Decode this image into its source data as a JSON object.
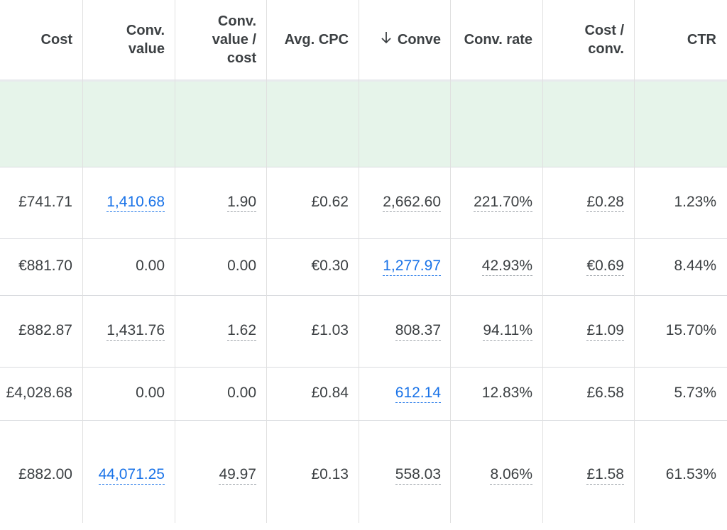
{
  "columns": [
    {
      "key": "cost",
      "label_lines": [
        "Cost"
      ]
    },
    {
      "key": "conv_value",
      "label_lines": [
        "Conv.",
        "value"
      ]
    },
    {
      "key": "conv_value_cost",
      "label_lines": [
        "Conv.",
        "value /",
        "cost"
      ]
    },
    {
      "key": "avg_cpc",
      "label_lines": [
        "Avg. CPC"
      ]
    },
    {
      "key": "conversions",
      "label_lines": [
        "Conve"
      ],
      "sorted": "desc"
    },
    {
      "key": "conv_rate",
      "label_lines": [
        "Conv. rate"
      ]
    },
    {
      "key": "cost_conv",
      "label_lines": [
        "Cost /",
        "conv."
      ]
    },
    {
      "key": "ctr",
      "label_lines": [
        "CTR"
      ]
    }
  ],
  "sort_icon": "arrow-down-icon",
  "rows": [
    {
      "cost": "£741.71",
      "conv_value": "1,410.68",
      "conv_value_cost": "1.90",
      "avg_cpc": "£0.62",
      "conversions": "2,662.60",
      "conv_rate": "221.70%",
      "cost_conv": "£0.28",
      "ctr": "1.23%"
    },
    {
      "cost": "€881.70",
      "conv_value": "0.00",
      "conv_value_cost": "0.00",
      "avg_cpc": "€0.30",
      "conversions": "1,277.97",
      "conv_rate": "42.93%",
      "cost_conv": "€0.69",
      "ctr": "8.44%"
    },
    {
      "cost": "£882.87",
      "conv_value": "1,431.76",
      "conv_value_cost": "1.62",
      "avg_cpc": "£1.03",
      "conversions": "808.37",
      "conv_rate": "94.11%",
      "cost_conv": "£1.09",
      "ctr": "15.70%"
    },
    {
      "cost": "£4,028.68",
      "conv_value": "0.00",
      "conv_value_cost": "0.00",
      "avg_cpc": "£0.84",
      "conversions": "612.14",
      "conv_rate": "12.83%",
      "cost_conv": "£6.58",
      "ctr": "5.73%"
    },
    {
      "cost": "£882.00",
      "conv_value": "44,071.25",
      "conv_value_cost": "49.97",
      "avg_cpc": "£0.13",
      "conversions": "558.03",
      "conv_rate": "8.06%",
      "cost_conv": "£1.58",
      "ctr": "61.53%"
    }
  ],
  "colors": {
    "link": "#1a73e8",
    "summary_bg": "#e6f4ea",
    "text": "#3c4043"
  }
}
